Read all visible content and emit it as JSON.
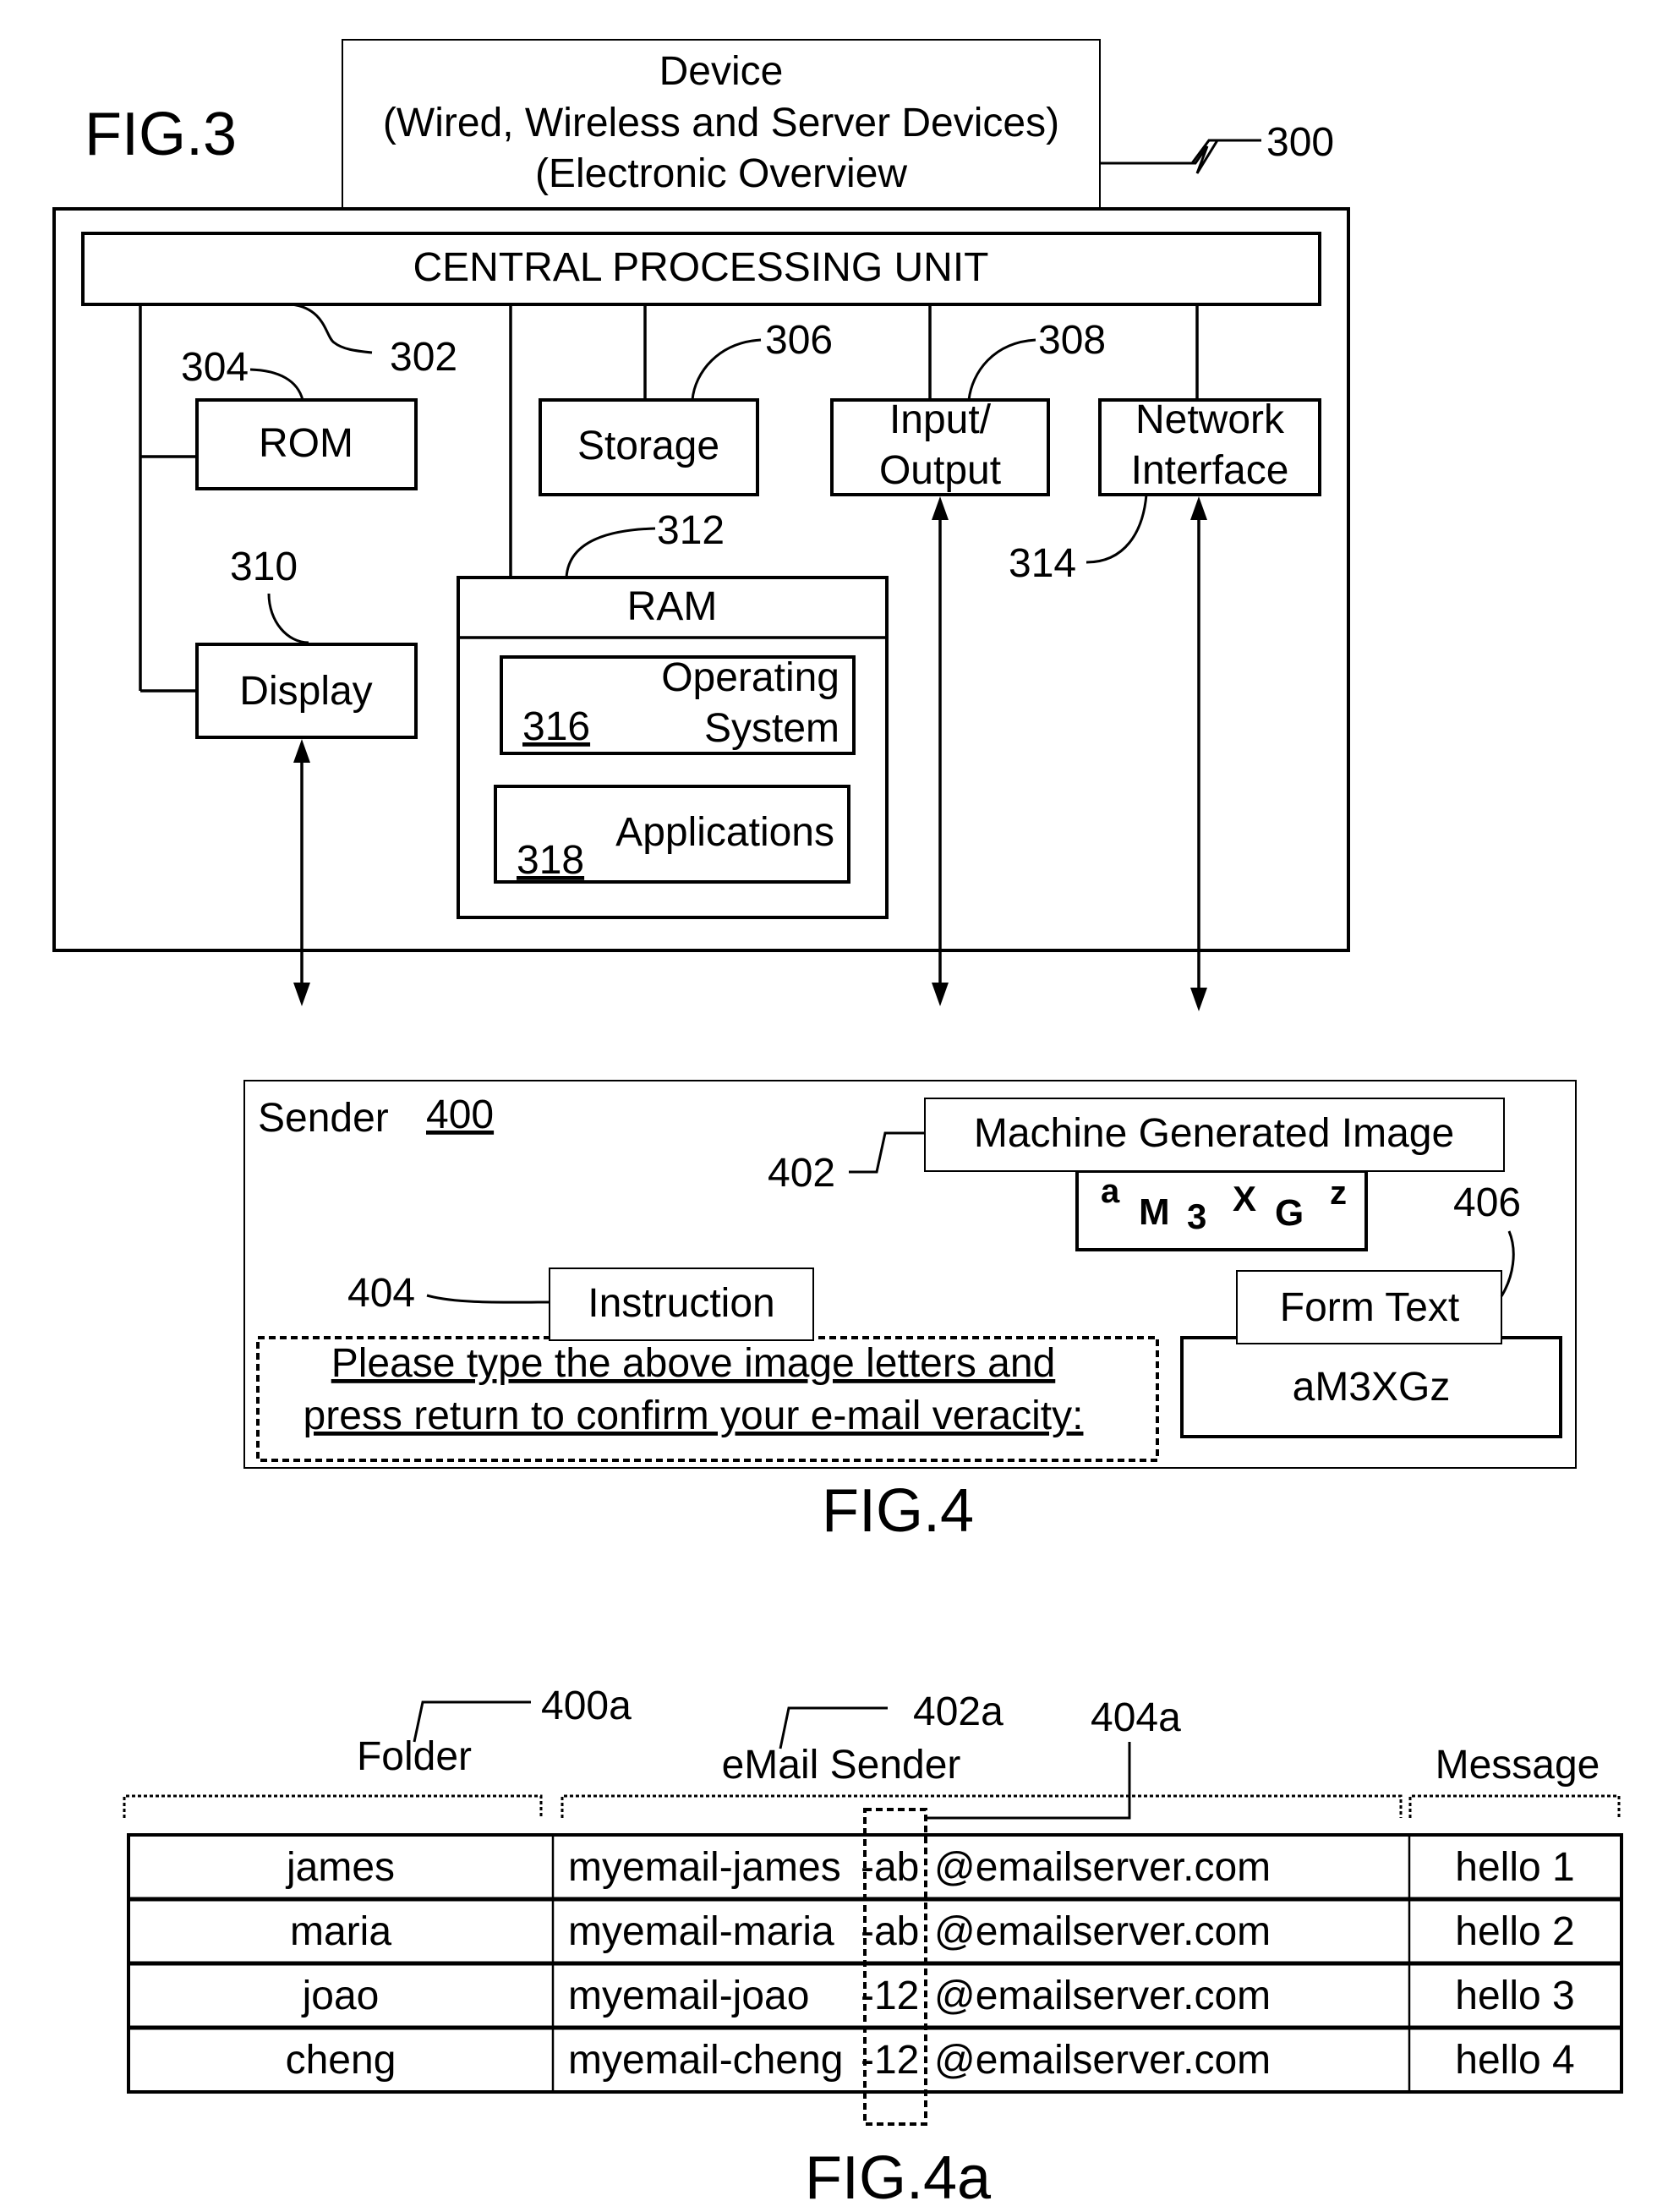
{
  "fig3": {
    "title": "FIG.3",
    "device_box": {
      "line1": "Device",
      "line2": "(Wired, Wireless and Server Devices)",
      "line3": "(Electronic Overview",
      "ref": "300"
    },
    "cpu": {
      "label": "CENTRAL PROCESSING UNIT",
      "ref": "302"
    },
    "rom": {
      "label": "ROM",
      "ref": "304"
    },
    "storage": {
      "label": "Storage",
      "ref": "306"
    },
    "io": {
      "line1": "Input/",
      "line2": "Output",
      "ref": "308"
    },
    "network": {
      "line1": "Network",
      "line2": "Interface",
      "ref": "314"
    },
    "display": {
      "label": "Display",
      "ref": "310"
    },
    "ram": {
      "label": "RAM",
      "ref": "312"
    },
    "os": {
      "line1": "Operating",
      "line2": "System",
      "ref": "316"
    },
    "apps": {
      "label": "Applications",
      "ref": "318"
    }
  },
  "fig4": {
    "title": "FIG.4",
    "sender": {
      "label": "Sender",
      "ref": "400"
    },
    "machine_image": {
      "label": "Machine Generated Image",
      "ref": "402",
      "captcha_chars": [
        "a",
        "M",
        "3",
        "X",
        "G",
        "z"
      ]
    },
    "instruction": {
      "label": "Instruction",
      "ref": "404",
      "line1": "Please type the above image letters and",
      "line2": "press return to confirm your e-mail veracity:"
    },
    "form_text": {
      "label": "Form Text",
      "ref": "406",
      "value": "aM3XGz"
    }
  },
  "fig4a": {
    "title": "FIG.4a",
    "columns": [
      {
        "label": "Folder",
        "ref": "400a"
      },
      {
        "label": "eMail Sender",
        "ref": "402a"
      },
      {
        "label": "Message",
        "ref": ""
      }
    ],
    "highlight_ref": "404a",
    "rows": [
      {
        "folder": "james",
        "prefix": "myemail-james",
        "tag": "-ab",
        "domain": "@emailserver.com",
        "message": "hello 1"
      },
      {
        "folder": "maria",
        "prefix": "myemail-maria",
        "tag": "-ab",
        "domain": "@emailserver.com",
        "message": "hello 2"
      },
      {
        "folder": "joao",
        "prefix": "myemail-joao",
        "tag": "-12",
        "domain": "@emailserver.com",
        "message": "hello 3"
      },
      {
        "folder": "cheng",
        "prefix": "myemail-cheng",
        "tag": "-12",
        "domain": "@emailserver.com",
        "message": "hello 4"
      }
    ]
  }
}
